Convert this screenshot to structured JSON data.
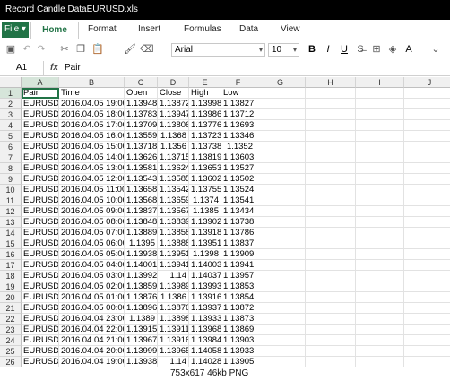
{
  "window": {
    "title": "Record Candle DataEURUSD.xls"
  },
  "ribbon": {
    "file_label": "File",
    "tabs": [
      "Home",
      "Format",
      "Insert",
      "Formulas",
      "Data",
      "View"
    ],
    "active_tab": "Home"
  },
  "toolbar": {
    "font": "Arial",
    "size": "10"
  },
  "formula_bar": {
    "cell_ref": "A1",
    "fx": "fx",
    "value": "Pair"
  },
  "columns": [
    "A",
    "B",
    "C",
    "D",
    "E",
    "F",
    "G",
    "H",
    "I",
    "J"
  ],
  "header_row": [
    "Pair",
    "Time",
    "Open",
    "Close",
    "High",
    "Low"
  ],
  "rows": [
    [
      "EURUSD",
      "2016.04.05 19:00",
      "1.13948",
      "1.13872",
      "1.13998",
      "1.13827"
    ],
    [
      "EURUSD",
      "2016.04.05 18:00",
      "1.13783",
      "1.13947",
      "1.13986",
      "1.13712"
    ],
    [
      "EURUSD",
      "2016.04.05 17:00",
      "1.13709",
      "1.13806",
      "1.13776",
      "1.13693"
    ],
    [
      "EURUSD",
      "2016.04.05 16:00",
      "1.13559",
      "1.1368",
      "1.13723",
      "1.13346"
    ],
    [
      "EURUSD",
      "2016.04.05 15:00",
      "1.13718",
      "1.1356",
      "1.13738",
      "1.1352"
    ],
    [
      "EURUSD",
      "2016.04.05 14:00",
      "1.13626",
      "1.13715",
      "1.13819",
      "1.13603"
    ],
    [
      "EURUSD",
      "2016.04.05 13:00",
      "1.13581",
      "1.13624",
      "1.13653",
      "1.13527"
    ],
    [
      "EURUSD",
      "2016.04.05 12:00",
      "1.13543",
      "1.13585",
      "1.13602",
      "1.13502"
    ],
    [
      "EURUSD",
      "2016.04.05 11:00",
      "1.13658",
      "1.13542",
      "1.13755",
      "1.13524"
    ],
    [
      "EURUSD",
      "2016.04.05 10:00",
      "1.13568",
      "1.13659",
      "1.1374",
      "1.13541"
    ],
    [
      "EURUSD",
      "2016.04.05 09:00",
      "1.13837",
      "1.13567",
      "1.1385",
      "1.13434"
    ],
    [
      "EURUSD",
      "2016.04.05 08:00",
      "1.13848",
      "1.13839",
      "1.13902",
      "1.13738"
    ],
    [
      "EURUSD",
      "2016.04.05 07:00",
      "1.13889",
      "1.13858",
      "1.13918",
      "1.13786"
    ],
    [
      "EURUSD",
      "2016.04.05 06:00",
      "1.1395",
      "1.13888",
      "1.13951",
      "1.13837"
    ],
    [
      "EURUSD",
      "2016.04.05 05:00",
      "1.13938",
      "1.13951",
      "1.1398",
      "1.13909"
    ],
    [
      "EURUSD",
      "2016.04.05 04:00",
      "1.14001",
      "1.13941",
      "1.14003",
      "1.13941"
    ],
    [
      "EURUSD",
      "2016.04.05 03:00",
      "1.13992",
      "1.14",
      "1.14037",
      "1.13957"
    ],
    [
      "EURUSD",
      "2016.04.05 02:00",
      "1.13859",
      "1.13989",
      "1.13993",
      "1.13853"
    ],
    [
      "EURUSD",
      "2016.04.05 01:00",
      "1.13876",
      "1.1386",
      "1.13916",
      "1.13854"
    ],
    [
      "EURUSD",
      "2016.04.05 00:00",
      "1.13896",
      "1.13876",
      "1.13937",
      "1.13872"
    ],
    [
      "EURUSD",
      "2016.04.04 23:00",
      "1.1389",
      "1.13898",
      "1.13933",
      "1.13873"
    ],
    [
      "EURUSD",
      "2016.04.04 22:00",
      "1.13915",
      "1.13911",
      "1.13968",
      "1.13869"
    ],
    [
      "EURUSD",
      "2016.04.04 21:00",
      "1.13967",
      "1.13916",
      "1.13984",
      "1.13903"
    ],
    [
      "EURUSD",
      "2016.04.04 20:00",
      "1.13999",
      "1.13965",
      "1.14058",
      "1.13933"
    ],
    [
      "EURUSD",
      "2016.04.04 19:00",
      "1.13938",
      "1.14",
      "1.14028",
      "1.13905"
    ]
  ],
  "footer": {
    "caption": "753x617  46kb  PNG"
  }
}
